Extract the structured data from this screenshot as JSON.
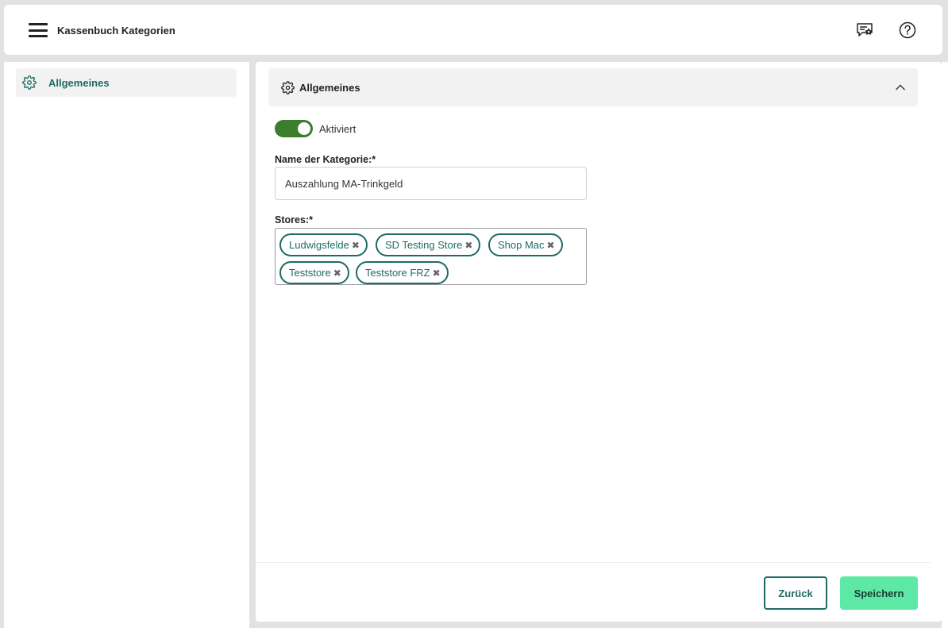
{
  "header": {
    "title": "Kassenbuch Kategorien",
    "icons": {
      "menu": "hamburger-icon",
      "feedback": "feedback-icon",
      "help": "help-icon"
    }
  },
  "sidebar": {
    "items": [
      {
        "label": "Allgemeines",
        "icon": "gear-icon",
        "active": true
      }
    ]
  },
  "section": {
    "title": "Allgemeines",
    "icon": "gear-icon",
    "expanded": true
  },
  "form": {
    "active_toggle": {
      "label": "Aktiviert",
      "on": true
    },
    "name_field": {
      "label": "Name der Kategorie:*",
      "value": "Auszahlung MA-Trinkgeld"
    },
    "stores_field": {
      "label": "Stores:*",
      "chips": [
        "Ludwigsfelde",
        "SD Testing Store",
        "Shop Mac",
        "Teststore",
        "Teststore FRZ"
      ],
      "remove_glyph": "✖"
    }
  },
  "footer": {
    "back_label": "Zurück",
    "save_label": "Speichern"
  },
  "colors": {
    "accent": "#1d6b63",
    "toggle_on": "#3b7d2c",
    "save_button": "#5ee8a6",
    "panel_header": "#f2f2f2"
  }
}
